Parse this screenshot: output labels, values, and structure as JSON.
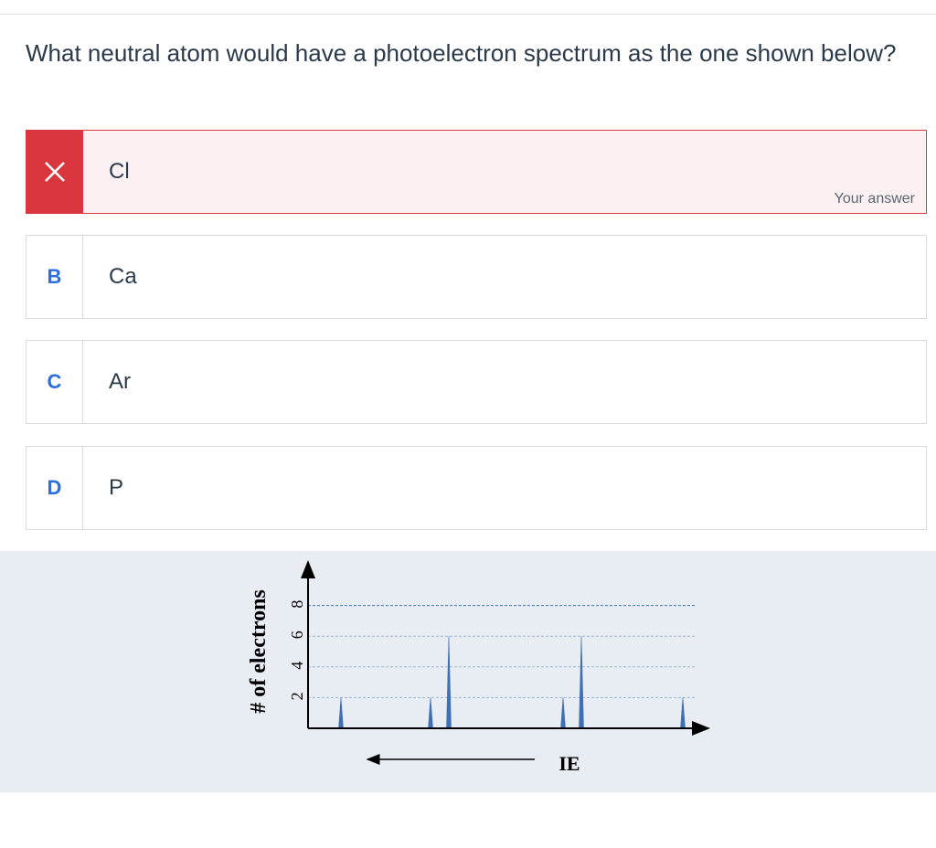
{
  "question": {
    "text": "What neutral atom would have a photoelectron spectrum as the one shown below?"
  },
  "options": [
    {
      "key": "×",
      "label": "Cl",
      "state": "wrong",
      "badge": "Your answer",
      "icon": "close-icon"
    },
    {
      "key": "B",
      "label": "Ca"
    },
    {
      "key": "C",
      "label": "Ar"
    },
    {
      "key": "D",
      "label": "P"
    }
  ],
  "colors": {
    "wrong_accent": "#d9363e",
    "wrong_background": "#fbf1f2",
    "key_blue": "#2a6fdb",
    "figure_background": "#e8edf3",
    "peak_fill": "#3f6fb5"
  },
  "chart_data": {
    "type": "bar",
    "xlabel": "IE",
    "ylabel": "# of electrons",
    "x_direction_arrow": "left",
    "yticks": [
      2,
      4,
      6,
      8
    ],
    "ylim": [
      0,
      9
    ],
    "grid": true,
    "peaks": [
      {
        "ie_rank": 1,
        "value": 2
      },
      {
        "ie_rank": 2,
        "value": 2
      },
      {
        "ie_rank": 3,
        "value": 6
      },
      {
        "ie_rank": 4,
        "value": 2
      },
      {
        "ie_rank": 5,
        "value": 6
      },
      {
        "ie_rank": 6,
        "value": 2
      }
    ]
  }
}
